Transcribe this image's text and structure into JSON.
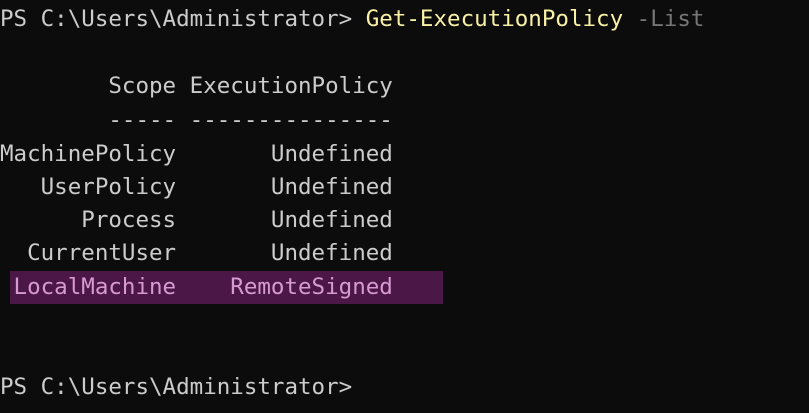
{
  "prompt1": "PS C:\\Users\\Administrator> ",
  "command": "Get-ExecutionPolicy",
  "param": " -List",
  "header": "        Scope ExecutionPolicy",
  "separator": "        ----- ---------------",
  "rows": [
    "MachinePolicy       Undefined",
    "   UserPolicy       Undefined",
    "      Process       Undefined",
    "  CurrentUser       Undefined",
    " LocalMachine    RemoteSigned"
  ],
  "prompt2": "PS C:\\Users\\Administrator>",
  "colors": {
    "background": "#0c0c0c",
    "text": "#cccccc",
    "command": "#f9f1a5",
    "parameter": "#767676",
    "selection_bg": "#4a1747",
    "selection_text": "#d79ad1"
  }
}
